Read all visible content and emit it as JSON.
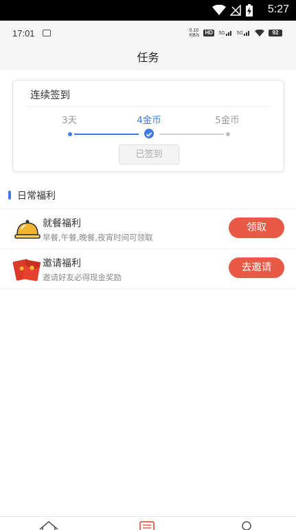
{
  "status_bar": {
    "time": "5:27"
  },
  "sub_status": {
    "time": "17:01",
    "net_speed_top": "0.10",
    "net_speed_bottom": "KB/s",
    "hd": "HD",
    "sig1": "5G",
    "sig2": "5G",
    "battery": "92"
  },
  "header": {
    "title": "任务"
  },
  "signin": {
    "title": "连续签到",
    "days": [
      {
        "label": "3天",
        "active": false
      },
      {
        "label": "4金币",
        "active": true
      },
      {
        "label": "5金币",
        "active": false
      }
    ],
    "button_label": "已签到"
  },
  "section": {
    "label": "日常福利"
  },
  "items": [
    {
      "title": "就餐福利",
      "desc": "早餐,午餐,晚餐,夜宵时间可领取",
      "button": "领取",
      "icon": "meal-bell-icon"
    },
    {
      "title": "邀请福利",
      "desc": "邀请好友必得现金奖励",
      "button": "去邀请",
      "icon": "red-envelope-icon"
    }
  ],
  "colors": {
    "accent": "#3f7be0",
    "button": "#e85a45"
  }
}
